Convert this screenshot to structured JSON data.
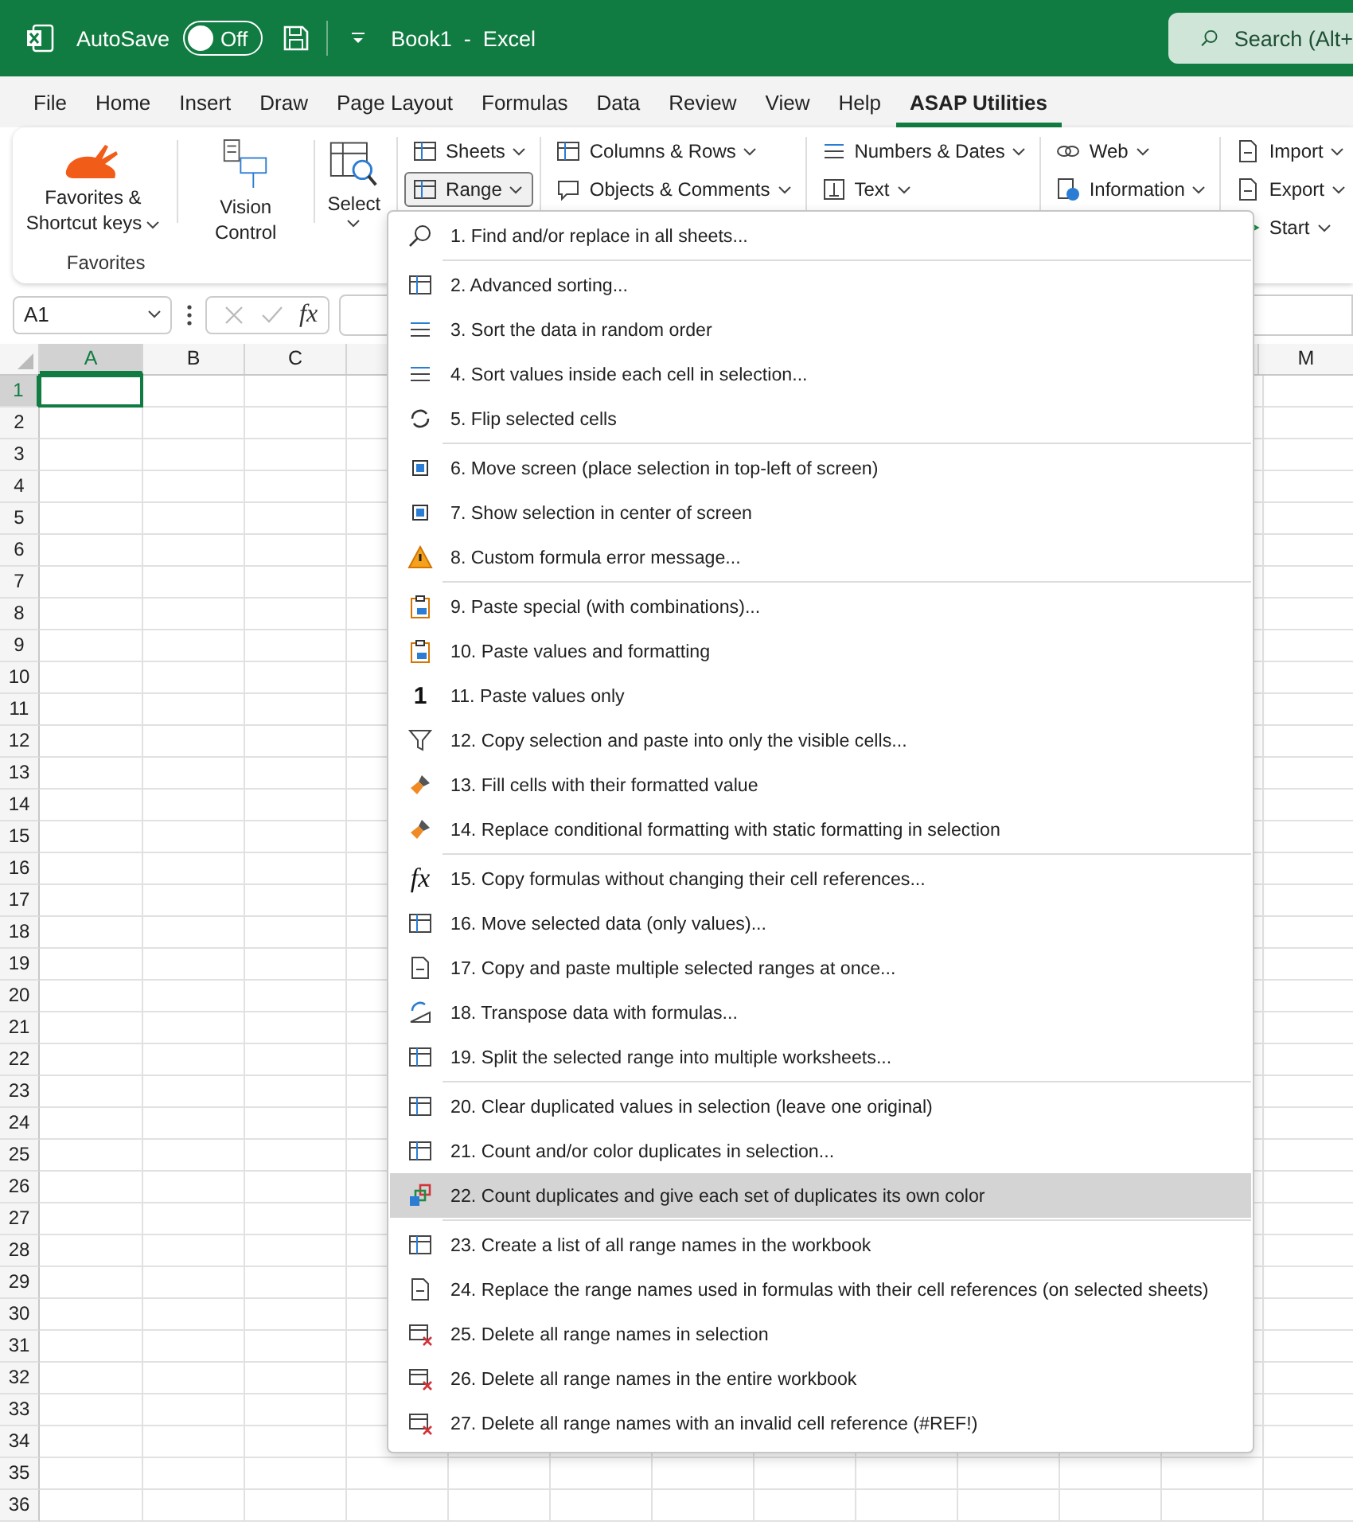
{
  "title_bar": {
    "autosave_label": "AutoSave",
    "autosave": {
      "on": false,
      "label": "Off"
    },
    "title": "Book1  -  Excel",
    "search": {
      "placeholder": "Search (Alt+"
    }
  },
  "tabs": [
    {
      "label": "File",
      "selected": false
    },
    {
      "label": "Home",
      "selected": false
    },
    {
      "label": "Insert",
      "selected": false
    },
    {
      "label": "Draw",
      "selected": false
    },
    {
      "label": "Page Layout",
      "selected": false
    },
    {
      "label": "Formulas",
      "selected": false
    },
    {
      "label": "Data",
      "selected": false
    },
    {
      "label": "Review",
      "selected": false
    },
    {
      "label": "View",
      "selected": false
    },
    {
      "label": "Help",
      "selected": false
    },
    {
      "label": "ASAP Utilities",
      "selected": true
    }
  ],
  "ribbon": {
    "large_buttons": [
      {
        "label": "Favorites & Shortcut keys",
        "caret": true
      },
      {
        "label": "Vision Control",
        "caret": false
      },
      {
        "label": "Select",
        "caret": true
      }
    ],
    "group_label": "Favorites",
    "columns": [
      [
        {
          "label": "Sheets",
          "open": false
        },
        {
          "label": "Range",
          "open": true
        }
      ],
      [
        {
          "label": "Columns & Rows",
          "open": false
        },
        {
          "label": "Objects & Comments",
          "open": false
        }
      ],
      [
        {
          "label": "Numbers & Dates",
          "open": false
        },
        {
          "label": "Text",
          "open": false
        }
      ],
      [
        {
          "label": "Web",
          "open": false
        },
        {
          "label": "Information",
          "open": false
        }
      ],
      [
        {
          "label": "Import",
          "open": false
        },
        {
          "label": "Export",
          "open": false
        },
        {
          "label": "Start",
          "open": false
        }
      ]
    ]
  },
  "formula_bar": {
    "name_box": "A1",
    "fx": "fx"
  },
  "sheet": {
    "columns": [
      {
        "label": "A",
        "selected": true
      },
      {
        "label": "B",
        "selected": false
      },
      {
        "label": "C",
        "selected": false
      }
    ],
    "last_column": {
      "label": "M",
      "selected": false
    },
    "rows": [
      {
        "label": "1",
        "selected": true
      },
      {
        "label": "2",
        "selected": false
      },
      {
        "label": "3",
        "selected": false
      },
      {
        "label": "4",
        "selected": false
      },
      {
        "label": "5",
        "selected": false
      },
      {
        "label": "6",
        "selected": false
      },
      {
        "label": "7",
        "selected": false
      },
      {
        "label": "8",
        "selected": false
      },
      {
        "label": "9",
        "selected": false
      },
      {
        "label": "10",
        "selected": false
      },
      {
        "label": "11",
        "selected": false
      },
      {
        "label": "12",
        "selected": false
      },
      {
        "label": "13",
        "selected": false
      },
      {
        "label": "14",
        "selected": false
      },
      {
        "label": "15",
        "selected": false
      },
      {
        "label": "16",
        "selected": false
      },
      {
        "label": "17",
        "selected": false
      },
      {
        "label": "18",
        "selected": false
      },
      {
        "label": "19",
        "selected": false
      },
      {
        "label": "20",
        "selected": false
      },
      {
        "label": "21",
        "selected": false
      },
      {
        "label": "22",
        "selected": false
      },
      {
        "label": "23",
        "selected": false
      },
      {
        "label": "24",
        "selected": false
      },
      {
        "label": "25",
        "selected": false
      },
      {
        "label": "26",
        "selected": false
      },
      {
        "label": "27",
        "selected": false
      },
      {
        "label": "28",
        "selected": false
      },
      {
        "label": "29",
        "selected": false
      },
      {
        "label": "30",
        "selected": false
      },
      {
        "label": "31",
        "selected": false
      },
      {
        "label": "32",
        "selected": false
      },
      {
        "label": "33",
        "selected": false
      },
      {
        "label": "34",
        "selected": false
      },
      {
        "label": "35",
        "selected": false
      },
      {
        "label": "36",
        "selected": false
      }
    ]
  },
  "range_menu": {
    "groups": [
      [
        {
          "label": "1. Find and/or replace in all sheets...",
          "selected": false
        }
      ],
      [
        {
          "label": "2. Advanced sorting...",
          "selected": false
        },
        {
          "label": "3. Sort the data in random order",
          "selected": false
        },
        {
          "label": "4. Sort values inside each cell in selection...",
          "selected": false
        },
        {
          "label": "5. Flip selected cells",
          "selected": false
        }
      ],
      [
        {
          "label": "6. Move screen (place selection in top-left of screen)",
          "selected": false
        },
        {
          "label": "7. Show selection in center of screen",
          "selected": false
        },
        {
          "label": "8. Custom formula error message...",
          "selected": false
        }
      ],
      [
        {
          "label": "9. Paste special (with combinations)...",
          "selected": false
        },
        {
          "label": "10. Paste values and formatting",
          "selected": false
        },
        {
          "label": "11. Paste values only",
          "selected": false,
          "glyph": "1"
        },
        {
          "label": "12. Copy selection and paste into only the visible cells...",
          "selected": false
        },
        {
          "label": "13. Fill cells with their formatted value",
          "selected": false
        },
        {
          "label": "14. Replace conditional formatting with static formatting in selection",
          "selected": false
        }
      ],
      [
        {
          "label": "15. Copy formulas without changing their cell references...",
          "selected": false,
          "glyph": "fx"
        },
        {
          "label": "16. Move selected data (only values)...",
          "selected": false
        },
        {
          "label": "17. Copy and paste multiple selected ranges at once...",
          "selected": false
        },
        {
          "label": "18. Transpose data with formulas...",
          "selected": false
        },
        {
          "label": "19. Split the selected range into multiple worksheets...",
          "selected": false
        }
      ],
      [
        {
          "label": "20. Clear duplicated values in selection (leave one original)",
          "selected": false
        },
        {
          "label": "21. Count and/or color duplicates in selection...",
          "selected": false
        },
        {
          "label": "22. Count duplicates and give each set of duplicates its own color",
          "selected": true
        }
      ],
      [
        {
          "label": "23. Create a list of all range names in the workbook",
          "selected": false
        },
        {
          "label": "24. Replace the range names used in formulas with their cell references (on selected sheets)",
          "selected": false
        },
        {
          "label": "25. Delete all range names in selection",
          "selected": false
        },
        {
          "label": "26. Delete all range names in the entire workbook",
          "selected": false
        },
        {
          "label": "27. Delete all range names with an invalid cell reference (#REF!)",
          "selected": false
        }
      ]
    ]
  }
}
